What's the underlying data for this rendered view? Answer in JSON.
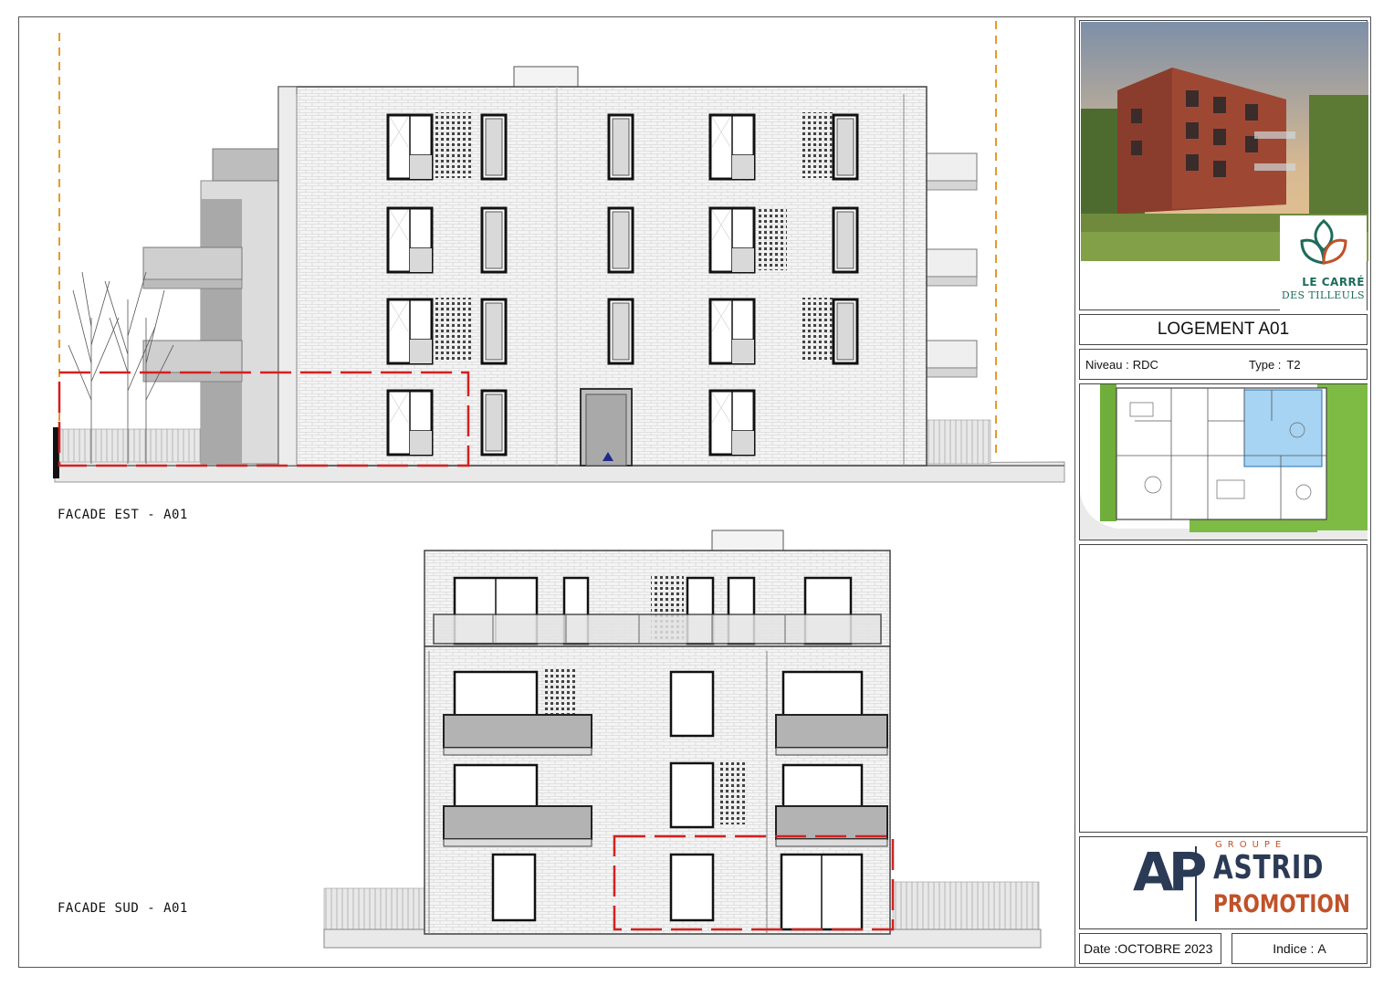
{
  "views": {
    "east": {
      "label": "FACADE EST - A01"
    },
    "south": {
      "label": "FACADE SUD - A01"
    }
  },
  "project": {
    "logo_line1": "LE CARRÉ",
    "logo_line2": "DES TILLEULS"
  },
  "unit": {
    "title": "LOGEMENT A01",
    "niveau_label": "Niveau :",
    "niveau_value": "RDC",
    "type_label": "Type :",
    "type_value": "T2"
  },
  "developer": {
    "monogram": "AP",
    "group": "GROUPE",
    "name_line1": "ASTRID",
    "name_line2": "PROMOTION"
  },
  "footer": {
    "date_label": "Date :",
    "date_value": "OCTOBRE 2023",
    "indice_label": "Indice :",
    "indice_value": "A"
  },
  "colors": {
    "accent_red": "#d42020",
    "guide_orange": "#e59a2a",
    "brand_green": "#1e6b5a",
    "brand_orange": "#c0522a",
    "brand_navy": "#2b3a55",
    "highlight_blue": "#a6d4f2"
  }
}
